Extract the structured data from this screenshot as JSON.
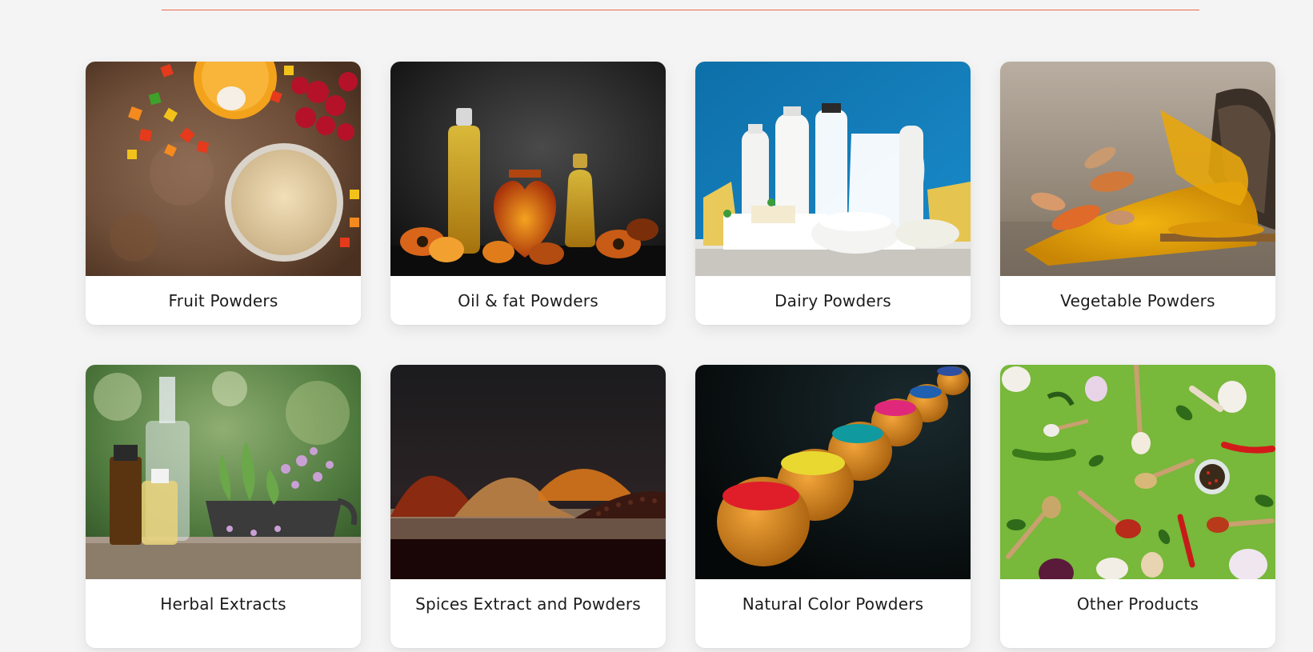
{
  "colors": {
    "page_background": "#f4f4f4",
    "divider": "#e8694f",
    "card_background": "#ffffff",
    "label_text": "#1c1c1c"
  },
  "categories": [
    {
      "label": "Fruit Powders",
      "image": "fruit-powders-photo"
    },
    {
      "label": "Oil & fat Powders",
      "image": "oil-fat-powders-photo"
    },
    {
      "label": "Dairy Powders",
      "image": "dairy-powders-photo"
    },
    {
      "label": "Vegetable Powders",
      "image": "vegetable-powders-photo"
    },
    {
      "label": "Herbal Extracts",
      "image": "herbal-extracts-photo"
    },
    {
      "label": "Spices Extract and Powders",
      "image": "spices-extract-photo"
    },
    {
      "label": "Natural Color Powders",
      "image": "natural-color-powders-photo"
    },
    {
      "label": "Other Products",
      "image": "other-products-photo"
    }
  ]
}
